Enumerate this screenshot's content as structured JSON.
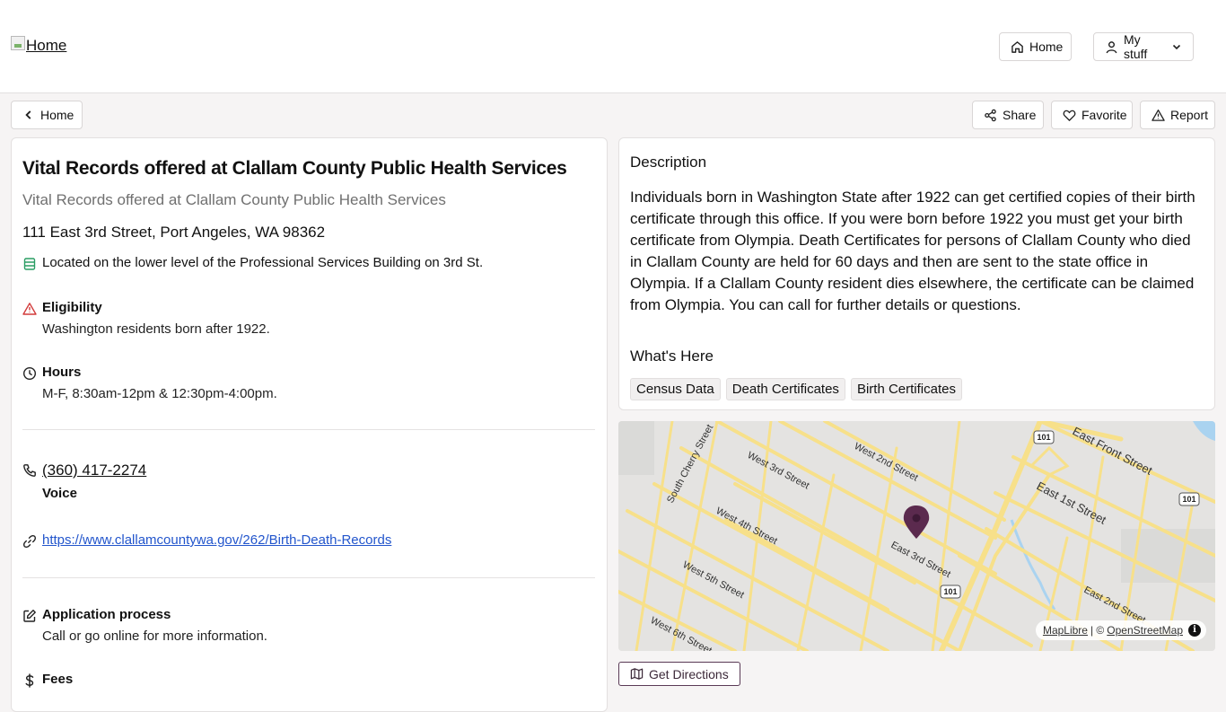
{
  "header": {
    "logo_alt": "Home",
    "home_label": "Home",
    "mystuff_label": "My stuff"
  },
  "actions": {
    "back_label": "Home",
    "share_label": "Share",
    "favorite_label": "Favorite",
    "report_label": "Report"
  },
  "listing": {
    "title": "Vital Records offered at Clallam County Public Health Services",
    "subtitle": "Vital Records offered at Clallam County Public Health Services",
    "address": "111 East 3rd Street, Port Angeles, WA 98362",
    "location_note": "Located on the lower level of the Professional Services Building on 3rd St.",
    "eligibility_label": "Eligibility",
    "eligibility_text": "Washington residents born after 1922.",
    "hours_label": "Hours",
    "hours_text": "M-F, 8:30am-12pm & 12:30pm-4:00pm.",
    "phone": "(360) 417-2274",
    "phone_type": "Voice",
    "website": "https://www.clallamcountywa.gov/262/Birth-Death-Records",
    "application_label": "Application process",
    "application_text": "Call or go online for more information.",
    "fees_label": "Fees"
  },
  "description": {
    "heading": "Description",
    "text": "Individuals born in Washington State after 1922 can get certified copies of their birth certificate through this office.  If you were born before 1922 you must get your birth certificate from Olympia. Death Certificates for persons of Clallam County who died in Clallam County are held for 60 days and then are sent to the state office in Olympia. If a Clallam County resident dies elsewhere, the certificate can be claimed from Olympia. You can call for further details or questions.",
    "whats_here_heading": "What's Here",
    "tags": [
      "Census Data",
      "Death Certificates",
      "Birth Certificates"
    ]
  },
  "map": {
    "streets": [
      "South Cherry Street",
      "West 3rd Street",
      "West 2nd Street",
      "East Front Street",
      "East 1st Street",
      "West 4th Street",
      "East 3rd Street",
      "West 5th Street",
      "West 6th Street",
      "East 2nd Street"
    ],
    "route_shields": [
      "101",
      "101",
      "101"
    ],
    "attribution_maplibre": "MapLibre",
    "attribution_sep": "| ©",
    "attribution_osm": "OpenStreetMap",
    "pin_color": "#5b2a4e",
    "road_color": "#f7e08a",
    "water_color": "#aad3f0"
  },
  "directions_label": "Get Directions"
}
